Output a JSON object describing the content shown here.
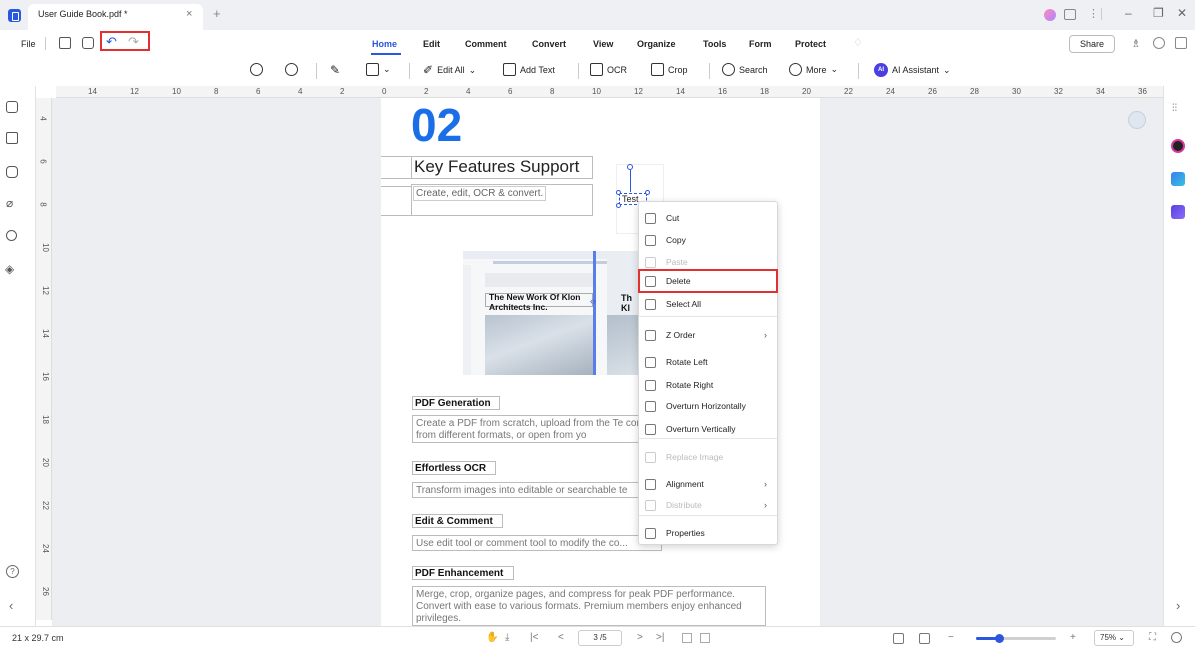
{
  "window": {
    "tab_title": "User Guide Book.pdf *",
    "tab_close": "×",
    "new_tab": "+",
    "minimize": "–",
    "restore": "❐",
    "close": "✕"
  },
  "menu": {
    "file": "File",
    "tabs": [
      "Home",
      "Edit",
      "Comment",
      "Convert",
      "View",
      "Organize",
      "Tools",
      "Form",
      "Protect"
    ],
    "active_tab": "Home",
    "share": "Share"
  },
  "toolbar": {
    "zoom_out_icon": "zoom-out-icon",
    "zoom_in_icon": "zoom-in-icon",
    "edit_all": "Edit All",
    "add_text": "Add Text",
    "ocr": "OCR",
    "crop": "Crop",
    "search": "Search",
    "more": "More",
    "ai_assistant": "AI Assistant",
    "ai_badge": "AI",
    "dropdown_caret": "⌄"
  },
  "ruler": {
    "h_ticks": [
      "14",
      "12",
      "10",
      "8",
      "6",
      "4",
      "2",
      "0",
      "2",
      "4",
      "6",
      "8",
      "10",
      "12",
      "14",
      "16",
      "18",
      "20",
      "22",
      "24",
      "26",
      "28",
      "30",
      "32",
      "34",
      "36"
    ],
    "v_ticks": [
      "4",
      "6",
      "8",
      "10",
      "12",
      "14",
      "16",
      "18",
      "20",
      "22",
      "24",
      "26"
    ]
  },
  "document": {
    "big_number": "02",
    "feature_title": "Key Features Support",
    "feature_subtitle": "Create, edit, OCR & convert.",
    "selected_text": "Test",
    "thumb_heading": "The New Work Of Klon Architects Inc.",
    "thumb_heading_right": "Th Kl",
    "sections": [
      {
        "title": "PDF Generation",
        "body": "Create a PDF from scratch, upload from the Te convert from different formats, or open from yo"
      },
      {
        "title": "Effortless OCR",
        "body": "Transform images into editable or searchable te"
      },
      {
        "title": "Edit & Comment",
        "body": "Use edit tool or comment tool to modify the co..."
      },
      {
        "title": "PDF Enhancement",
        "body": "Merge, crop, organize pages, and compress for peak PDF performance. Convert with ease to various formats. Premium members enjoy enhanced privileges."
      }
    ]
  },
  "context_menu": {
    "items": [
      {
        "label": "Cut",
        "icon": "scissors-icon",
        "enabled": true
      },
      {
        "label": "Copy",
        "icon": "copy-icon",
        "enabled": true
      },
      {
        "label": "Paste",
        "icon": "paste-icon",
        "enabled": false
      },
      {
        "label": "Delete",
        "icon": "trash-icon",
        "enabled": true
      },
      {
        "label": "Select All",
        "icon": "select-all-icon",
        "enabled": true
      },
      {
        "label": "Z Order",
        "icon": "z-order-icon",
        "enabled": true,
        "submenu": true
      },
      {
        "label": "Rotate Left",
        "icon": "rotate-left-icon",
        "enabled": true
      },
      {
        "label": "Rotate Right",
        "icon": "rotate-right-icon",
        "enabled": true
      },
      {
        "label": "Overturn Horizontally",
        "icon": "flip-horizontal-icon",
        "enabled": true
      },
      {
        "label": "Overturn Vertically",
        "icon": "flip-vertical-icon",
        "enabled": true
      },
      {
        "label": "Replace Image",
        "icon": "replace-image-icon",
        "enabled": false
      },
      {
        "label": "Alignment",
        "icon": "align-icon",
        "enabled": true,
        "submenu": true
      },
      {
        "label": "Distribute",
        "icon": "distribute-icon",
        "enabled": false,
        "submenu": true
      },
      {
        "label": "Properties",
        "icon": "properties-icon",
        "enabled": true
      }
    ],
    "submenu_arrow": "›"
  },
  "status": {
    "page_size": "21 x 29.7 cm",
    "page_indicator": "3 /5",
    "zoom": "75%",
    "nav_first": "|<",
    "nav_prev": "<",
    "nav_next": ">",
    "nav_last": ">|",
    "zoom_out": "−",
    "zoom_in": "+",
    "zoom_caret": "⌄",
    "help": "?",
    "collapse_left": "‹",
    "collapse_right": "›"
  },
  "colors": {
    "accent": "#2a56e0",
    "highlight": "#e03030",
    "number_blue": "#1a6fe8"
  }
}
